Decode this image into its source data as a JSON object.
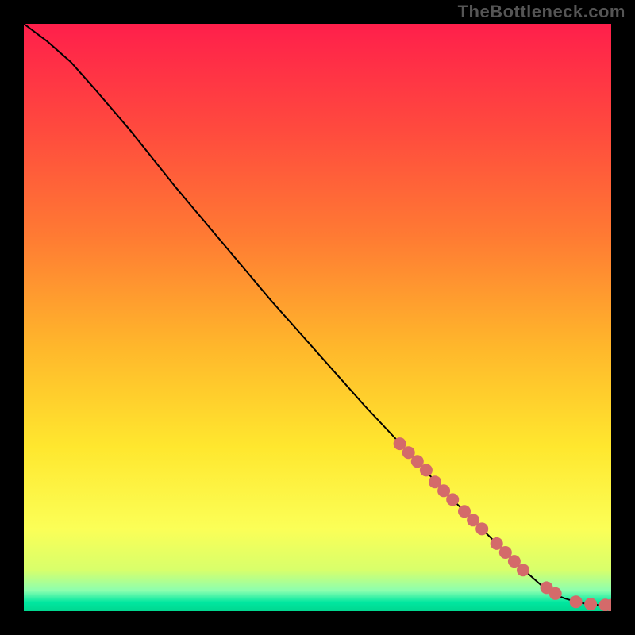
{
  "watermark": "TheBottleneck.com",
  "chart_data": {
    "type": "line",
    "title": "",
    "xlabel": "",
    "ylabel": "",
    "xlim": [
      0,
      100
    ],
    "ylim": [
      0,
      100
    ],
    "background_gradient": {
      "stops": [
        {
          "offset": 0.0,
          "color": "#ff1f4b"
        },
        {
          "offset": 0.18,
          "color": "#ff4a3e"
        },
        {
          "offset": 0.36,
          "color": "#ff7a33"
        },
        {
          "offset": 0.55,
          "color": "#ffb72b"
        },
        {
          "offset": 0.72,
          "color": "#ffe72e"
        },
        {
          "offset": 0.86,
          "color": "#fbff57"
        },
        {
          "offset": 0.93,
          "color": "#d8ff6b"
        },
        {
          "offset": 0.965,
          "color": "#8bffb0"
        },
        {
          "offset": 0.985,
          "color": "#00e7a0"
        },
        {
          "offset": 1.0,
          "color": "#00d78f"
        }
      ]
    },
    "curve": {
      "x": [
        0,
        4,
        8,
        12,
        18,
        26,
        34,
        42,
        50,
        58,
        66,
        72,
        78,
        84,
        88,
        90,
        92,
        94,
        96,
        98,
        100
      ],
      "y": [
        100,
        97,
        93.5,
        89,
        82,
        72,
        62.5,
        53,
        44,
        35,
        26.5,
        20,
        14,
        8,
        4.5,
        3,
        2.2,
        1.6,
        1.2,
        1.05,
        1
      ]
    },
    "scatter_points": [
      {
        "x": 64,
        "y": 28.5
      },
      {
        "x": 65.5,
        "y": 27
      },
      {
        "x": 67,
        "y": 25.5
      },
      {
        "x": 68.5,
        "y": 24
      },
      {
        "x": 70,
        "y": 22
      },
      {
        "x": 71.5,
        "y": 20.5
      },
      {
        "x": 73,
        "y": 19
      },
      {
        "x": 75,
        "y": 17
      },
      {
        "x": 76.5,
        "y": 15.5
      },
      {
        "x": 78,
        "y": 14
      },
      {
        "x": 80.5,
        "y": 11.5
      },
      {
        "x": 82,
        "y": 10
      },
      {
        "x": 83.5,
        "y": 8.5
      },
      {
        "x": 85,
        "y": 7
      },
      {
        "x": 89,
        "y": 4
      },
      {
        "x": 90.5,
        "y": 3
      },
      {
        "x": 94,
        "y": 1.6
      },
      {
        "x": 96.5,
        "y": 1.2
      },
      {
        "x": 99,
        "y": 1.05
      },
      {
        "x": 100,
        "y": 1
      }
    ],
    "point_color": "#d46a6a",
    "curve_color": "#000000",
    "point_radius": 8
  }
}
